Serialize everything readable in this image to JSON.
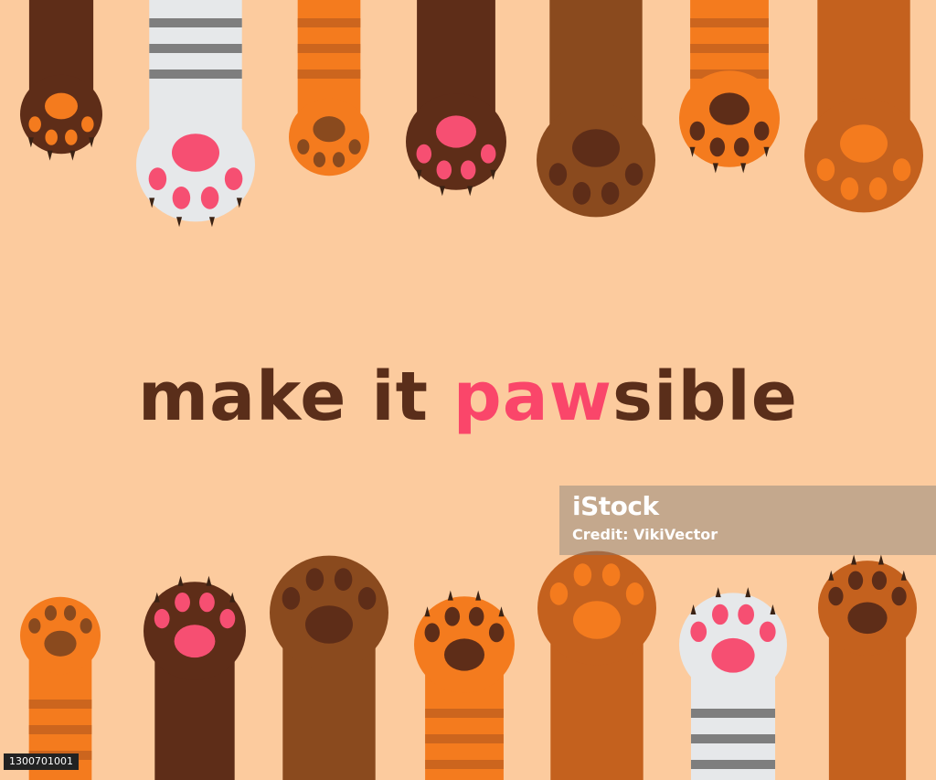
{
  "background_color": "#FCCB9E",
  "headline": {
    "part1": "make it ",
    "part2": "paw",
    "part3": "sible",
    "main_color": "#5A2E1A",
    "accent_color": "#FA466A"
  },
  "watermark": {
    "brand": "iStock",
    "credit": "Credit: VikiVector"
  },
  "image_id": "1300701001",
  "palette": {
    "dark_brown": "#5E2D18",
    "brown": "#8A4A1E",
    "rust": "#C4611E",
    "orange": "#F47B1E",
    "grey": "#6B6B6B",
    "light_grey": "#E6E8EA",
    "pink": "#F64F72",
    "claw": "#3A2214"
  },
  "paws_top": [
    {
      "fur": "dark_brown",
      "pad": "orange",
      "claws": true
    },
    {
      "fur": "light_grey",
      "pad": "pink",
      "claws": true
    },
    {
      "fur": "orange",
      "pad": "brown",
      "claws": false
    },
    {
      "fur": "dark_brown",
      "pad": "pink",
      "claws": true
    },
    {
      "fur": "brown",
      "pad": "dark_brown",
      "claws": false
    },
    {
      "fur": "orange",
      "pad": "dark_brown",
      "claws": true
    },
    {
      "fur": "rust",
      "pad": "orange",
      "claws": false
    }
  ],
  "paws_bottom": [
    {
      "fur": "orange",
      "pad": "brown",
      "claws": false
    },
    {
      "fur": "dark_brown",
      "pad": "pink",
      "claws": true
    },
    {
      "fur": "brown",
      "pad": "dark_brown",
      "claws": false
    },
    {
      "fur": "orange",
      "pad": "dark_brown",
      "claws": true
    },
    {
      "fur": "rust",
      "pad": "orange",
      "claws": false
    },
    {
      "fur": "light_grey",
      "pad": "pink",
      "claws": true
    },
    {
      "fur": "rust",
      "pad": "dark_brown",
      "claws": true
    }
  ]
}
